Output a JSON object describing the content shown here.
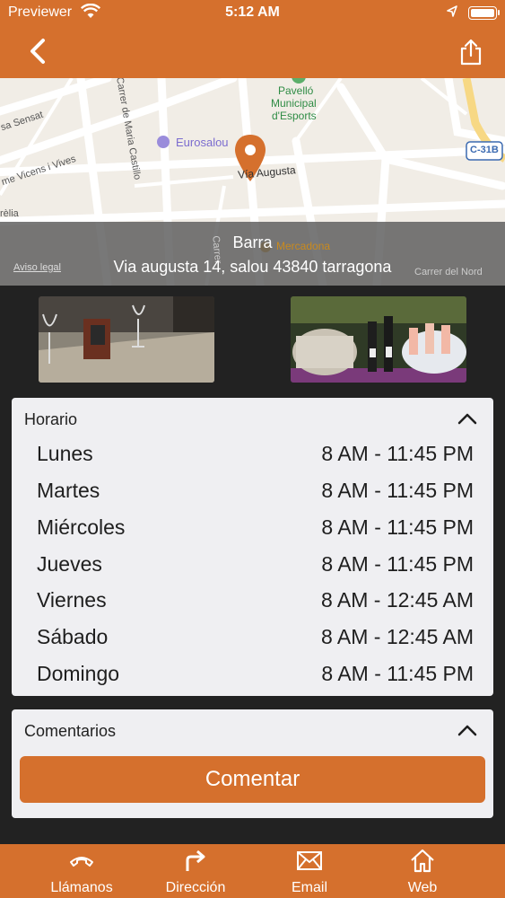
{
  "status_bar": {
    "carrier": "Previewer",
    "time": "5:12 AM"
  },
  "nav": {
    "back_icon": "chevron-left-icon",
    "share_icon": "share-icon"
  },
  "map": {
    "title": "Barra",
    "address": "Via augusta 14, salou 43840 tarragona",
    "legal": "Aviso legal",
    "labels": {
      "poi1": "Pavelló",
      "poi1b": "Municipal",
      "poi1c": "d'Esports",
      "hotel": "Eurosalou",
      "street1": "Vía Augusta",
      "street2": "Carrer de Maria Castillo",
      "street3": "sa Sensat",
      "street4": "me Vicens i Vives",
      "street5": "rèlia",
      "road": "C-31B",
      "mercadona": "Mercadona",
      "nord": "Carrer del Nord",
      "carrer": "Carrer"
    }
  },
  "horario": {
    "title": "Horario",
    "days": [
      {
        "day": "Lunes",
        "hours": "8 AM - 11:45 PM"
      },
      {
        "day": "Martes",
        "hours": "8 AM - 11:45 PM"
      },
      {
        "day": "Miércoles",
        "hours": "8 AM - 11:45 PM"
      },
      {
        "day": "Jueves",
        "hours": "8 AM - 11:45 PM"
      },
      {
        "day": "Viernes",
        "hours": "8 AM - 12:45 AM"
      },
      {
        "day": "Sábado",
        "hours": "8 AM - 12:45 AM"
      },
      {
        "day": "Domingo",
        "hours": "8 AM - 11:45 PM"
      }
    ]
  },
  "comentarios": {
    "title": "Comentarios",
    "button": "Comentar"
  },
  "tabs": [
    {
      "label": "Llámanos",
      "icon": "phone-icon"
    },
    {
      "label": "Dirección",
      "icon": "turn-right-arrow-icon"
    },
    {
      "label": "Email",
      "icon": "envelope-icon"
    },
    {
      "label": "Web",
      "icon": "home-icon"
    }
  ],
  "colors": {
    "accent": "#d5702d",
    "background": "#222222",
    "card": "#efeff2"
  }
}
